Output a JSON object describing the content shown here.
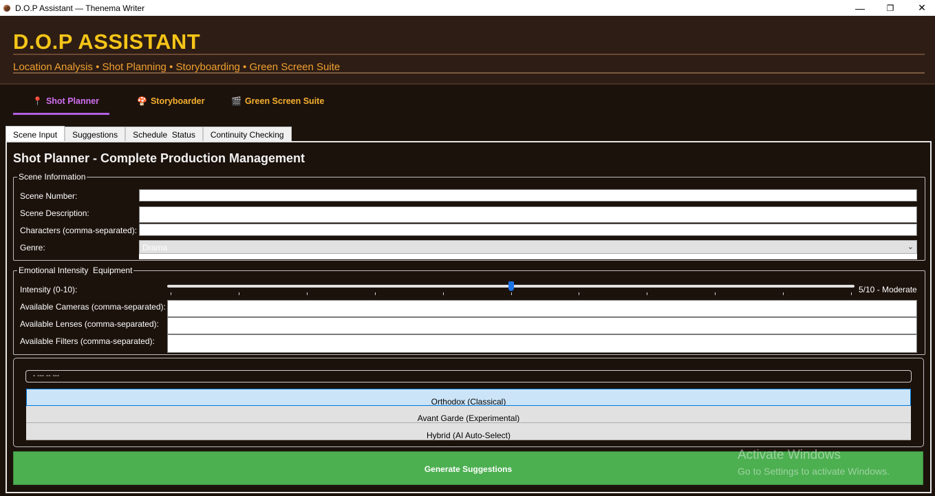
{
  "window": {
    "title": "D.O.P Assistant — Thenema Writer",
    "minimize": "—",
    "maximize": "❐",
    "close": "✕"
  },
  "header": {
    "title": "D.O.P ASSISTANT",
    "subtitle": "Location Analysis • Shot Planning • Storyboarding • Green Screen Suite"
  },
  "main_tabs": [
    {
      "label": "Shot Planner",
      "icon": "pin-icon",
      "glyph": "📍",
      "active": true
    },
    {
      "label": "Storyboarder",
      "icon": "mushroom-icon",
      "glyph": "🍄",
      "active": false
    },
    {
      "label": "Green Screen Suite",
      "icon": "clapper-icon",
      "glyph": "🎬",
      "active": false
    }
  ],
  "sub_tabs": [
    {
      "label": "Scene Input",
      "active": true
    },
    {
      "label": "Suggestions",
      "active": false
    },
    {
      "label": "Schedule  Status",
      "active": false
    },
    {
      "label": "Continuity Checking",
      "active": false
    }
  ],
  "panel": {
    "title": "Shot Planner - Complete Production Management",
    "scene_info": {
      "legend": "Scene Information",
      "scene_number_label": "Scene Number:",
      "scene_number_value": "",
      "scene_description_label": "Scene Description:",
      "scene_description_value": "",
      "characters_label": "Characters (comma-separated):",
      "characters_value": "",
      "genre_label": "Genre:",
      "genre_value": "Drama"
    },
    "emotional": {
      "legend": "Emotional Intensity  Equipment",
      "intensity_label": "Intensity (0-10):",
      "intensity_value": 5,
      "intensity_max": 10,
      "intensity_text": "5/10 - Moderate",
      "cameras_label": "Available Cameras (comma-separated):",
      "lenses_label": "Available Lenses (comma-separated):",
      "filters_label": "Available Filters (comma-separated):"
    },
    "style": {
      "heading": "- --- -- ---",
      "options": [
        {
          "label": "Orthodox (Classical)",
          "selected": true
        },
        {
          "label": "Avant Garde (Experimental)",
          "selected": false
        },
        {
          "label": "Hybrid (AI Auto-Select)",
          "selected": false
        }
      ]
    },
    "generate_button": "Generate Suggestions"
  },
  "watermark": {
    "line1": "Activate Windows",
    "line2": "Go to Settings to activate Windows."
  },
  "colors": {
    "title": "#f5c518",
    "subtitle": "#f0a030",
    "active_tab": "#d070f0",
    "button": "#4caf50"
  }
}
